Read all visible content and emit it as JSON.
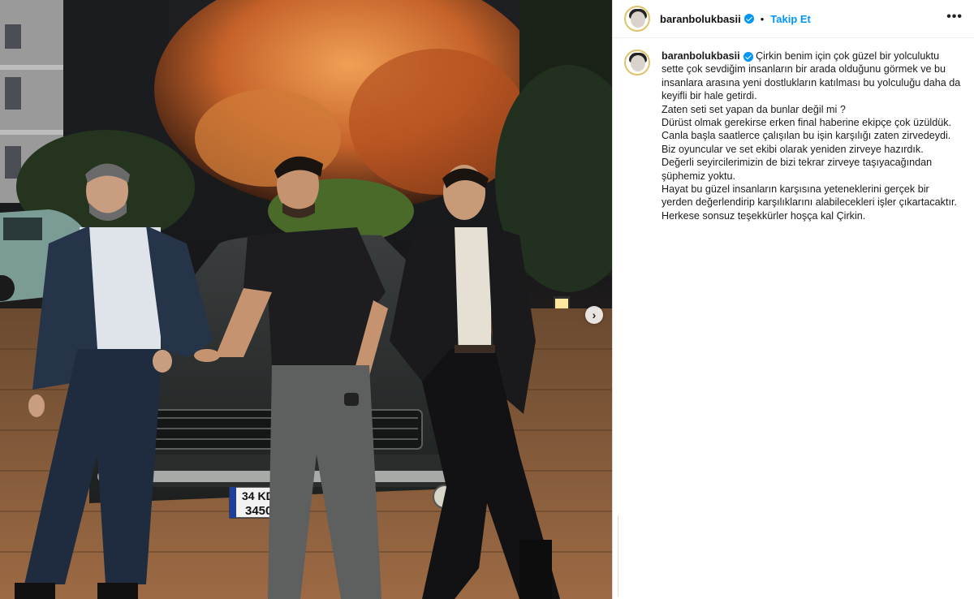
{
  "photo": {
    "plate_line1": "34 KDF",
    "plate_line2": "34501",
    "next_label": "›"
  },
  "header": {
    "username": "baranbolukbasii",
    "separator": "•",
    "follow_label": "Takip Et",
    "more_label": "•••"
  },
  "caption": {
    "username": "baranbolukbasii",
    "lines": [
      "Çirkin benim için çok güzel bir yolculuktu",
      "sette çok sevdiğim insanların bir arada olduğunu görmek ve bu",
      "insanlara arasına yeni dostlukların katılması bu yolculuğu daha da",
      "keyifli bir hale getirdi.",
      "Zaten seti set yapan da bunlar değil mi ?",
      "Dürüst olmak gerekirse erken final haberine ekipçe çok üzüldük.",
      "Canla başla saatlerce çalışılan bu işin karşılığı zaten zirvedeydi.",
      "Biz oyuncular ve set ekibi olarak yeniden zirveye hazırdık.",
      "Değerli seyircilerimizin de bizi tekrar zirveye taşıyacağından",
      "şüphemiz yoktu.",
      "Hayat bu güzel insanların karşısına yeteneklerini gerçek bir",
      "yerden değerlendirip karşılıklarını alabilecekleri işler çıkartacaktır.",
      "Herkese sonsuz teşekkürler hoşça kal Çirkin."
    ]
  },
  "colors": {
    "link": "#0095f6",
    "verified": "#0095f6",
    "text": "#1a1a1a"
  },
  "icons": {
    "verified": "verified-badge-icon",
    "more": "more-options-icon",
    "next": "chevron-right-icon"
  }
}
